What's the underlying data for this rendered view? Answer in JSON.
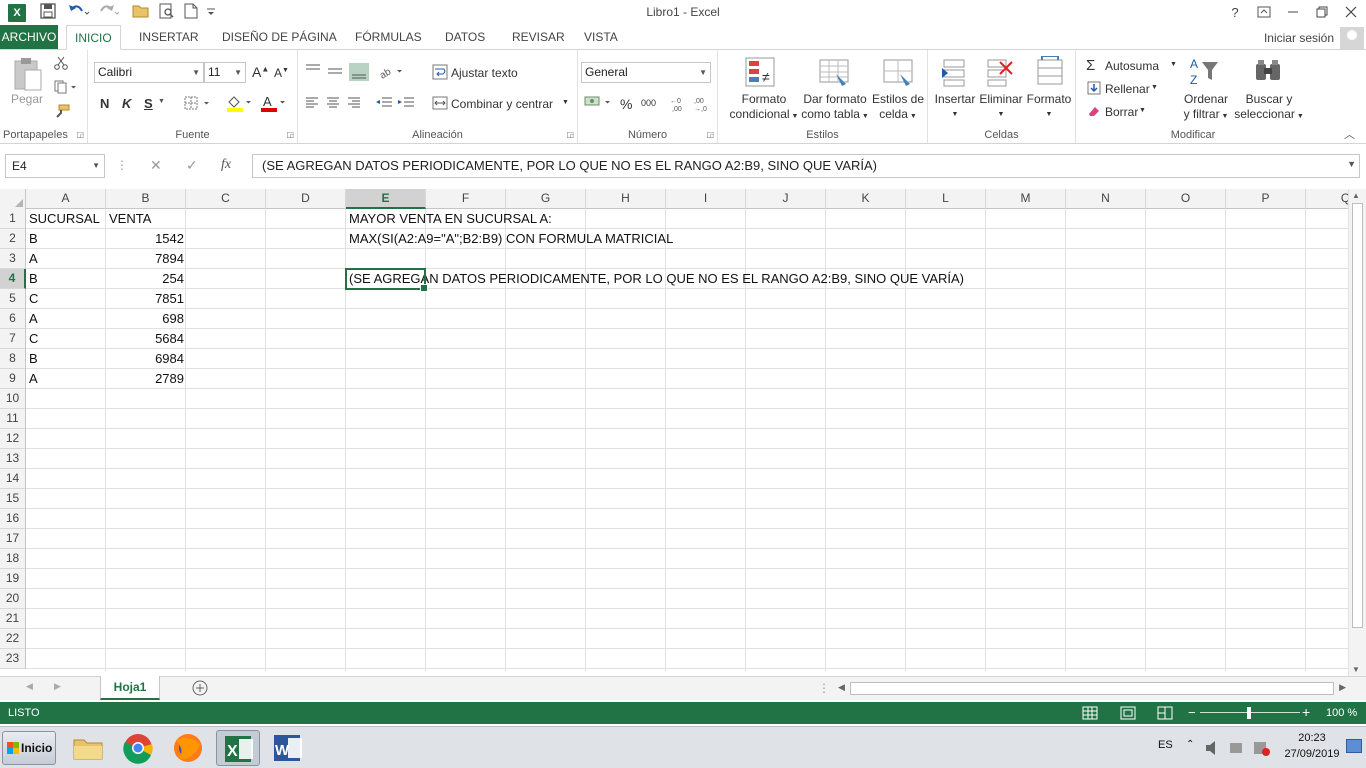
{
  "window": {
    "title": "Libro1 - Excel",
    "help_label": "?",
    "controls": [
      "minimize-button",
      "restore-button",
      "close-button"
    ]
  },
  "qat": {
    "items": [
      "excel-logo-icon",
      "save-icon",
      "undo-icon",
      "redo-icon",
      "open-icon",
      "print-preview-icon",
      "new-icon",
      "customize-qat-icon"
    ]
  },
  "ribbon": {
    "tabs": [
      "ARCHIVO",
      "INICIO",
      "INSERTAR",
      "DISEÑO DE PÁGINA",
      "FÓRMULAS",
      "DATOS",
      "REVISAR",
      "VISTA"
    ],
    "active_tab": "INICIO",
    "signin_label": "Iniciar sesión",
    "clipboard": {
      "label": "Portapapeles",
      "paste_label": "Pegar"
    },
    "font": {
      "label": "Fuente",
      "font_name": "Calibri",
      "font_size": "11",
      "bold": "N",
      "italic": "K",
      "underline": "S"
    },
    "alignment": {
      "label": "Alineación",
      "wrap_label": "Ajustar texto",
      "merge_label": "Combinar y centrar"
    },
    "number": {
      "label": "Número",
      "format": "General"
    },
    "styles": {
      "label": "Estilos",
      "conditional_line1": "Formato",
      "conditional_line2": "condicional",
      "table_line1": "Dar formato",
      "table_line2": "como tabla",
      "cell_line1": "Estilos de",
      "cell_line2": "celda"
    },
    "cells": {
      "label": "Celdas",
      "insert_label": "Insertar",
      "delete_label": "Eliminar",
      "format_label": "Formato"
    },
    "editing": {
      "label": "Modificar",
      "autosum_label": "Autosuma",
      "fill_label": "Rellenar",
      "clear_label": "Borrar",
      "sort_line1": "Ordenar",
      "sort_line2": "y filtrar",
      "find_line1": "Buscar y",
      "find_line2": "seleccionar"
    }
  },
  "formula_bar": {
    "name_box": "E4",
    "fx_label": "fx",
    "content": "(SE AGREGAN DATOS PERIODICAMENTE, POR LO QUE NO ES EL RANGO A2:B9, SINO QUE VARÍA)"
  },
  "grid": {
    "columns": [
      "A",
      "B",
      "C",
      "D",
      "E",
      "F",
      "G",
      "H",
      "I",
      "J",
      "K",
      "L",
      "M",
      "N",
      "O",
      "P",
      "Q"
    ],
    "rows": [
      "1",
      "2",
      "3",
      "4",
      "5",
      "6",
      "7",
      "8",
      "9",
      "10",
      "11",
      "12",
      "13",
      "14",
      "15",
      "16",
      "17",
      "18",
      "19",
      "20",
      "21",
      "22",
      "23"
    ],
    "selected_column": "E",
    "selected_row": "4",
    "cells": {
      "A1": "SUCURSAL",
      "B1": "VENTA",
      "A2": "B",
      "B2": "1542",
      "A3": "A",
      "B3": "7894",
      "A4": "B",
      "B4": "254",
      "A5": "C",
      "B5": "7851",
      "A6": "A",
      "B6": "698",
      "A7": "C",
      "B7": "5684",
      "A8": "B",
      "B8": "6984",
      "A9": "A",
      "B9": "2789",
      "E1": "MAYOR VENTA EN SUCURSAL A:",
      "E2": "MAX(SI(A2:A9=\"A\";B2:B9) CON FORMULA MATRICIAL",
      "E4": "(SE AGREGAN DATOS PERIODICAMENTE, POR LO QUE NO ES EL RANGO A2:B9, SINO QUE VARÍA)"
    }
  },
  "sheets": {
    "tabs": [
      "Hoja1"
    ],
    "active": "Hoja1"
  },
  "status": {
    "mode": "LISTO",
    "zoom": "100 %",
    "zoom_minus": "−",
    "zoom_plus": "+"
  },
  "taskbar": {
    "start_label": "Inicio",
    "lang": "ES",
    "time": "20:23",
    "date": "27/09/2019"
  },
  "colors": {
    "excel_green": "#217346"
  }
}
